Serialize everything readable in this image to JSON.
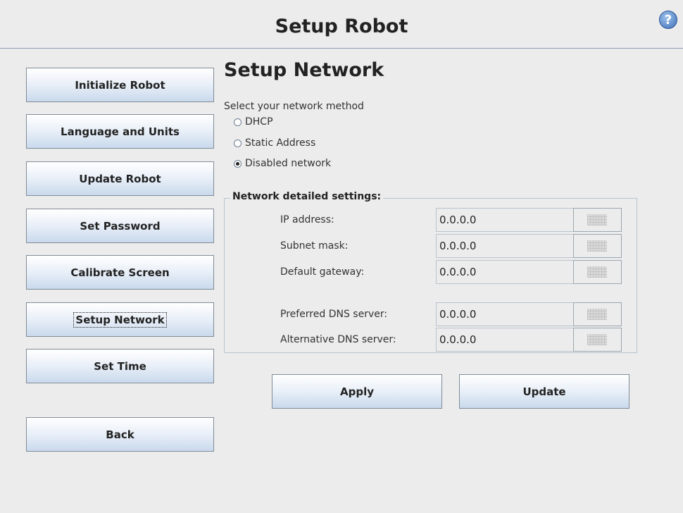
{
  "header": {
    "title": "Setup Robot",
    "help_icon": "?"
  },
  "sidebar": {
    "items": [
      {
        "label": "Initialize Robot"
      },
      {
        "label": "Language and Units"
      },
      {
        "label": "Update Robot"
      },
      {
        "label": "Set Password"
      },
      {
        "label": "Calibrate Screen"
      },
      {
        "label": "Setup Network",
        "active": true
      },
      {
        "label": "Set Time"
      }
    ],
    "back_label": "Back"
  },
  "main": {
    "title": "Setup Network",
    "method_prompt": "Select your network method",
    "methods": [
      {
        "label": "DHCP",
        "selected": false
      },
      {
        "label": "Static Address",
        "selected": false
      },
      {
        "label": "Disabled network",
        "selected": true
      }
    ],
    "details": {
      "legend": "Network detailed settings:",
      "fields": [
        {
          "label": "IP address:",
          "value": "0.0.0.0"
        },
        {
          "label": "Subnet mask:",
          "value": "0.0.0.0"
        },
        {
          "label": "Default gateway:",
          "value": "0.0.0.0"
        },
        {
          "label": "Preferred DNS server:",
          "value": "0.0.0.0"
        },
        {
          "label": "Alternative DNS server:",
          "value": "0.0.0.0"
        }
      ]
    },
    "apply_label": "Apply",
    "update_label": "Update"
  }
}
